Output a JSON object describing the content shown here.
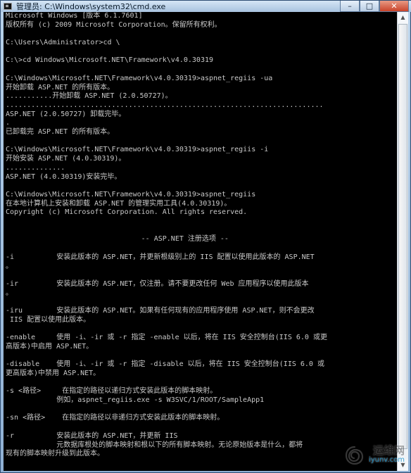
{
  "window": {
    "title": "管理员: C:\\Windows\\system32\\cmd.exe",
    "controls": {
      "minimize": "–",
      "maximize": "□",
      "close": "✕"
    }
  },
  "console": {
    "lines": [
      "Microsoft Windows [版本 6.1.7601]",
      "版权所有 (c) 2009 Microsoft Corporation。保留所有权利。",
      "",
      "C:\\Users\\Administrator>cd \\",
      "",
      "C:\\>cd Windows\\Microsoft.NET\\Framework\\v4.0.30319",
      "",
      "C:\\Windows\\Microsoft.NET\\Framework\\v4.0.30319>aspnet_regiis -ua",
      "开始卸载 ASP.NET 的所有版本。",
      "...........开始卸载 ASP.NET (2.0.50727)。",
      "...........................................................................",
      "ASP.NET (2.0.50727) 卸载完毕。",
      ".",
      "已卸载完 ASP.NET 的所有版本。",
      "",
      "C:\\Windows\\Microsoft.NET\\Framework\\v4.0.30319>aspnet_regiis -i",
      "开始安装 ASP.NET (4.0.30319)。",
      "..............",
      "ASP.NET (4.0.30319)安装完毕。",
      "",
      "C:\\Windows\\Microsoft.NET\\Framework\\v4.0.30319>aspnet_regiis",
      "在本地计算机上安装和卸载 ASP.NET 的管理实用工具(4.0.30319)。",
      "Copyright (c) Microsoft Corporation. All rights reserved.",
      "",
      "",
      "                                -- ASP.NET 注册选项 --",
      "",
      "-i          安装此版本的 ASP.NET，并更新根级别上的 IIS 配置以使用此版本的 ASP.NET",
      "。",
      "",
      "-ir         安装此版本的 ASP.NET，仅注册。请不要更改任何 Web 应用程序以使用此版本",
      "。",
      "",
      "-iru        安装此版本的 ASP.NET。如果有任何现有的应用程序使用 ASP.NET，则不会更改",
      " IIS 配置以使用此版本。",
      "",
      "-enable     使用 -i、-ir 或 -r 指定 -enable 以后，将在 IIS 安全控制台(IIS 6.0 或更",
      "高版本)中启用 ASP.NET。",
      "",
      "-disable    使用 -i、-ir 或 -r 指定 -disable 以后，将在 IIS 安全控制台(IIS 6.0 或",
      "更高版本)中禁用 ASP.NET。",
      "",
      "-s <路径>     在指定的路径以递归方式安装此版本的脚本映射。",
      "            例如，aspnet_regiis.exe -s W3SVC/1/ROOT/SampleApp1",
      "",
      "-sn <路径>    在指定的路径以非递归方式安装此版本的脚本映射。",
      "",
      "-r          安装此版本的 ASP.NET，并更新 IIS",
      "            元数据库根处的脚本映射和根以下的所有脚本映射。无论原始版本是什么，都将",
      "现有的脚本映射升级到此版本。"
    ]
  },
  "scrollbar": {
    "up_glyph": "▲",
    "down_glyph": "▼"
  },
  "watermark": {
    "brand": "运维网",
    "url": "iyunv.com"
  }
}
